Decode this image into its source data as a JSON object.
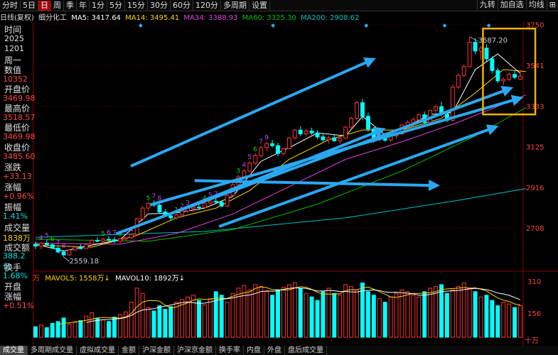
{
  "toolbar": {
    "items": [
      {
        "label": "分时",
        "active": false
      },
      {
        "label": "5日",
        "active": false
      },
      {
        "label": "日",
        "active": true
      },
      {
        "label": "周",
        "active": false
      },
      {
        "label": "季",
        "active": false
      },
      {
        "label": "年",
        "active": false
      },
      {
        "label": "1分",
        "active": false
      },
      {
        "label": "5分",
        "active": false
      },
      {
        "label": "15分",
        "active": false
      },
      {
        "label": "30分",
        "active": false
      },
      {
        "label": "60分",
        "active": false
      },
      {
        "label": "120分",
        "active": false
      },
      {
        "label": "多周期",
        "active": false
      },
      {
        "label": "设置",
        "active": false
      }
    ],
    "right": [
      {
        "label": "九转"
      },
      {
        "label": "加自选"
      },
      {
        "label": "均线"
      },
      {
        "label": "⊞"
      }
    ]
  },
  "ma_bar": {
    "title": "日线(复权)",
    "sector": "细分化工",
    "ma5": "MA5: 3417.64",
    "ma14": "MA14: 3495.41",
    "ma34": "MA34: 3388.93",
    "ma60": "MA60: 3325.30",
    "ma200": "MA200: 2908.62",
    "colors": {
      "ma5": "#ffffff",
      "ma14": "#ffd400",
      "ma34": "#e040e0",
      "ma60": "#00c000",
      "ma200": "#00c0c0",
      "up": "#ff3333",
      "down": "#00ffff"
    }
  },
  "sidebar": {
    "time_label": "时间",
    "year": "2025",
    "date": "1201",
    "weekday": "周一",
    "value_label": "数值",
    "value": "10352",
    "open_label": "开盘价",
    "open": "3469.98",
    "high_label": "最高价",
    "high": "3518.57",
    "low_label": "最低价",
    "low": "3469.98",
    "close_label": "收盘价",
    "close": "3485.60",
    "change_label": "涨跌",
    "change": "+33.13",
    "pct_label": "涨幅",
    "pct": "+0.96%",
    "amp_label": "振幅",
    "amp": "1.41%",
    "vol_label": "成交量",
    "vol": "1838万",
    "amt_label": "成交额",
    "amt": "388.2亿",
    "turn_label": "换手",
    "turn": "1.68%",
    "openpct_label": "开盘",
    "openpct_label2": "涨幅",
    "openpct": "+0.51%"
  },
  "volume_bar": {
    "unit": "万",
    "mavol5": "MAVOL5: 1558万↓",
    "mavol10": "MAVOL10: 1892万↓",
    "scale_top": "310",
    "scale_mid": "156",
    "scale_unit": "十万"
  },
  "chart_data": {
    "type": "candlestick",
    "price_axis": {
      "ticks": [
        3750,
        3541,
        3333,
        3125,
        2916,
        2708
      ],
      "ylim": [
        2530,
        3760
      ]
    },
    "annotations": {
      "high_label": "3687.20",
      "low_label": "2559.18"
    },
    "candles": [
      [
        2625,
        2640,
        2600,
        2615
      ],
      [
        2615,
        2635,
        2598,
        2630
      ],
      [
        2630,
        2648,
        2620,
        2622
      ],
      [
        2622,
        2630,
        2600,
        2605
      ],
      [
        2605,
        2612,
        2578,
        2585
      ],
      [
        2585,
        2595,
        2559,
        2570
      ],
      [
        2570,
        2600,
        2565,
        2595
      ],
      [
        2595,
        2615,
        2590,
        2610
      ],
      [
        2610,
        2625,
        2598,
        2602
      ],
      [
        2602,
        2630,
        2600,
        2625
      ],
      [
        2625,
        2650,
        2618,
        2645
      ],
      [
        2645,
        2660,
        2635,
        2640
      ],
      [
        2640,
        2658,
        2628,
        2650
      ],
      [
        2650,
        2665,
        2640,
        2648
      ],
      [
        2648,
        2662,
        2630,
        2640
      ],
      [
        2640,
        2655,
        2630,
        2652
      ],
      [
        2652,
        2665,
        2642,
        2658
      ],
      [
        2658,
        2680,
        2650,
        2675
      ],
      [
        2675,
        2760,
        2670,
        2755
      ],
      [
        2755,
        2820,
        2745,
        2810
      ],
      [
        2810,
        2840,
        2795,
        2835
      ],
      [
        2835,
        2850,
        2815,
        2825
      ],
      [
        2825,
        2840,
        2780,
        2790
      ],
      [
        2790,
        2805,
        2765,
        2770
      ],
      [
        2770,
        2785,
        2745,
        2760
      ],
      [
        2760,
        2780,
        2750,
        2775
      ],
      [
        2775,
        2800,
        2768,
        2795
      ],
      [
        2795,
        2815,
        2785,
        2808
      ],
      [
        2808,
        2825,
        2790,
        2815
      ],
      [
        2815,
        2830,
        2800,
        2812
      ],
      [
        2812,
        2840,
        2808,
        2835
      ],
      [
        2835,
        2855,
        2820,
        2845
      ],
      [
        2845,
        2862,
        2830,
        2840
      ],
      [
        2840,
        2850,
        2815,
        2820
      ],
      [
        2820,
        2880,
        2815,
        2875
      ],
      [
        2875,
        2940,
        2870,
        2930
      ],
      [
        2930,
        2980,
        2920,
        2970
      ],
      [
        2970,
        3010,
        2955,
        3000
      ],
      [
        3000,
        3050,
        2990,
        3040
      ],
      [
        3040,
        3090,
        3030,
        3080
      ],
      [
        3080,
        3130,
        3070,
        3120
      ],
      [
        3120,
        3150,
        3100,
        3140
      ],
      [
        3140,
        3160,
        3120,
        3130
      ],
      [
        3130,
        3145,
        3075,
        3090
      ],
      [
        3090,
        3120,
        3080,
        3115
      ],
      [
        3115,
        3175,
        3110,
        3170
      ],
      [
        3170,
        3215,
        3160,
        3210
      ],
      [
        3210,
        3230,
        3180,
        3190
      ],
      [
        3190,
        3215,
        3180,
        3205
      ],
      [
        3205,
        3222,
        3185,
        3195
      ],
      [
        3195,
        3210,
        3165,
        3175
      ],
      [
        3175,
        3190,
        3150,
        3160
      ],
      [
        3160,
        3180,
        3140,
        3170
      ],
      [
        3170,
        3185,
        3150,
        3155
      ],
      [
        3155,
        3175,
        3140,
        3168
      ],
      [
        3168,
        3230,
        3162,
        3225
      ],
      [
        3225,
        3280,
        3215,
        3270
      ],
      [
        3270,
        3360,
        3260,
        3350
      ],
      [
        3350,
        3370,
        3260,
        3280
      ],
      [
        3280,
        3300,
        3200,
        3215
      ],
      [
        3215,
        3225,
        3145,
        3160
      ],
      [
        3160,
        3190,
        3150,
        3185
      ],
      [
        3185,
        3195,
        3150,
        3158
      ],
      [
        3158,
        3185,
        3150,
        3180
      ],
      [
        3180,
        3200,
        3165,
        3190
      ],
      [
        3190,
        3240,
        3185,
        3235
      ],
      [
        3235,
        3260,
        3220,
        3250
      ],
      [
        3250,
        3275,
        3230,
        3262
      ],
      [
        3262,
        3295,
        3255,
        3288
      ],
      [
        3288,
        3305,
        3240,
        3250
      ],
      [
        3250,
        3315,
        3245,
        3310
      ],
      [
        3310,
        3340,
        3300,
        3330
      ],
      [
        3330,
        3355,
        3280,
        3290
      ],
      [
        3290,
        3300,
        3250,
        3260
      ],
      [
        3260,
        3440,
        3255,
        3430
      ],
      [
        3430,
        3500,
        3420,
        3490
      ],
      [
        3490,
        3545,
        3480,
        3535
      ],
      [
        3535,
        3687,
        3530,
        3660
      ],
      [
        3660,
        3680,
        3600,
        3615
      ],
      [
        3615,
        3640,
        3570,
        3630
      ],
      [
        3630,
        3650,
        3560,
        3575
      ],
      [
        3575,
        3590,
        3500,
        3515
      ],
      [
        3515,
        3530,
        3450,
        3462
      ],
      [
        3462,
        3480,
        3440,
        3470
      ],
      [
        3470,
        3505,
        3460,
        3495
      ],
      [
        3495,
        3515,
        3470,
        3480
      ],
      [
        3470,
        3519,
        3470,
        3486
      ]
    ],
    "ma_lines": {
      "ma5": [
        [
          0,
          2625
        ],
        [
          5,
          2590
        ],
        [
          10,
          2620
        ],
        [
          15,
          2648
        ],
        [
          20,
          2780
        ],
        [
          25,
          2785
        ],
        [
          30,
          2810
        ],
        [
          35,
          2870
        ],
        [
          40,
          3050
        ],
        [
          45,
          3120
        ],
        [
          50,
          3195
        ],
        [
          55,
          3180
        ],
        [
          58,
          3280
        ],
        [
          62,
          3185
        ],
        [
          66,
          3230
        ],
        [
          70,
          3290
        ],
        [
          74,
          3300
        ],
        [
          78,
          3520
        ],
        [
          82,
          3600
        ],
        [
          86,
          3500
        ]
      ],
      "ma14": [
        [
          0,
          2620
        ],
        [
          10,
          2610
        ],
        [
          18,
          2670
        ],
        [
          25,
          2760
        ],
        [
          32,
          2810
        ],
        [
          38,
          2900
        ],
        [
          45,
          3060
        ],
        [
          52,
          3160
        ],
        [
          58,
          3210
        ],
        [
          65,
          3210
        ],
        [
          72,
          3270
        ],
        [
          78,
          3400
        ],
        [
          83,
          3520
        ],
        [
          87,
          3510
        ]
      ],
      "ma34": [
        [
          0,
          2630
        ],
        [
          15,
          2625
        ],
        [
          25,
          2680
        ],
        [
          35,
          2780
        ],
        [
          45,
          2920
        ],
        [
          55,
          3060
        ],
        [
          65,
          3150
        ],
        [
          75,
          3250
        ],
        [
          87,
          3390
        ]
      ],
      "ma60": [
        [
          0,
          2650
        ],
        [
          20,
          2640
        ],
        [
          35,
          2700
        ],
        [
          50,
          2830
        ],
        [
          65,
          3000
        ],
        [
          78,
          3180
        ],
        [
          87,
          3325
        ]
      ],
      "ma200": [
        [
          0,
          2660
        ],
        [
          30,
          2690
        ],
        [
          55,
          2760
        ],
        [
          75,
          2850
        ],
        [
          87,
          2910
        ]
      ]
    },
    "td_counts": [
      {
        "i": 1,
        "n": "4"
      },
      {
        "i": 2,
        "n": "5"
      },
      {
        "i": 3,
        "n": "6"
      },
      {
        "i": 4,
        "n": "7"
      },
      {
        "i": 5,
        "n": "8"
      },
      {
        "i": 12,
        "n": "5"
      },
      {
        "i": 13,
        "n": "6"
      },
      {
        "i": 14,
        "n": "7"
      },
      {
        "i": 15,
        "n": "9"
      },
      {
        "i": 16,
        "n": "3"
      },
      {
        "i": 17,
        "n": "4"
      },
      {
        "i": 20,
        "n": "5"
      },
      {
        "i": 21,
        "n": "7"
      },
      {
        "i": 22,
        "n": "8"
      },
      {
        "i": 25,
        "n": "1"
      },
      {
        "i": 26,
        "n": "2"
      },
      {
        "i": 27,
        "n": "3"
      },
      {
        "i": 30,
        "n": "4"
      },
      {
        "i": 31,
        "n": "5"
      },
      {
        "i": 32,
        "n": "7"
      },
      {
        "i": 36,
        "n": "3"
      },
      {
        "i": 37,
        "n": "4"
      },
      {
        "i": 38,
        "n": "5"
      },
      {
        "i": 39,
        "n": "6"
      },
      {
        "i": 40,
        "n": "7"
      },
      {
        "i": 41,
        "n": "9"
      }
    ],
    "volumes": [
      60,
      70,
      55,
      80,
      90,
      110,
      75,
      85,
      95,
      120,
      140,
      110,
      100,
      90,
      115,
      130,
      145,
      200,
      280,
      250,
      170,
      150,
      180,
      160,
      175,
      200,
      215,
      230,
      240,
      210,
      185,
      220,
      260,
      240,
      200,
      250,
      280,
      295,
      270,
      300,
      290,
      260,
      240,
      270,
      285,
      300,
      310,
      280,
      250,
      230,
      210,
      260,
      280,
      250,
      240,
      300,
      290,
      270,
      310,
      260,
      240,
      220,
      200,
      230,
      250,
      270,
      260,
      240,
      230,
      260,
      280,
      290,
      300,
      250,
      270,
      290,
      310,
      280,
      260,
      230,
      240,
      210,
      180,
      200,
      190,
      170,
      180
    ],
    "arrows": [
      {
        "x1": 0.33,
        "y1": 0.66,
        "x2": 0.83,
        "y2": 0.68
      },
      {
        "x1": 0.29,
        "y1": 0.79,
        "x2": 0.72,
        "y2": 0.45
      },
      {
        "x1": 0.38,
        "y1": 0.85,
        "x2": 0.95,
        "y2": 0.44
      },
      {
        "x1": 0.17,
        "y1": 0.88,
        "x2": 0.98,
        "y2": 0.28
      },
      {
        "x1": 0.2,
        "y1": 0.6,
        "x2": 0.7,
        "y2": 0.16
      },
      {
        "x1": 0.24,
        "y1": 0.76,
        "x2": 1.0,
        "y2": 0.32
      }
    ]
  },
  "bottom_tabs": [
    {
      "label": "成交量",
      "active": true
    },
    {
      "label": "多周期成交量",
      "active": false
    },
    {
      "label": "虚拟成交量",
      "active": false
    },
    {
      "label": "金额",
      "active": false
    },
    {
      "label": "沪深金额",
      "active": false
    },
    {
      "label": "沪深京金额",
      "active": false
    },
    {
      "label": "换手率",
      "active": false
    },
    {
      "label": "内盘",
      "active": false
    },
    {
      "label": "外盘",
      "active": false
    },
    {
      "label": "盘后成交量",
      "active": false
    }
  ]
}
